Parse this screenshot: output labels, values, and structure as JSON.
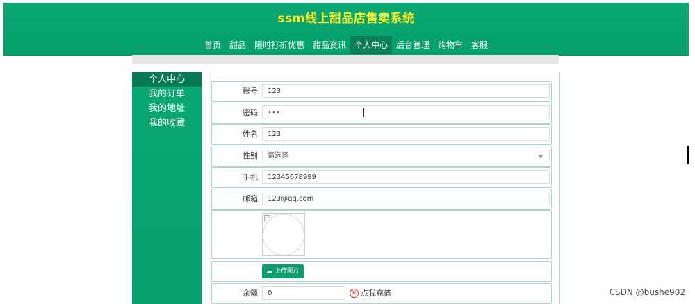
{
  "site": {
    "title": "ssm线上甜品店售卖系统"
  },
  "nav": {
    "items": [
      "首页",
      "甜品",
      "限时打折优惠",
      "甜品资讯",
      "个人中心",
      "后台管理",
      "购物车",
      "客服"
    ]
  },
  "sidebar": {
    "items": [
      "个人中心",
      "我的订单",
      "我的地址",
      "我的收藏"
    ]
  },
  "form": {
    "account": {
      "label": "账号",
      "value": "123"
    },
    "password": {
      "label": "密码",
      "value": "•••"
    },
    "name": {
      "label": "姓名",
      "value": "123"
    },
    "gender": {
      "label": "性别",
      "value": "请选择"
    },
    "phone": {
      "label": "手机",
      "value": "12345678999"
    },
    "email": {
      "label": "邮箱",
      "value": "123@qq.com"
    },
    "upload_label": "上传图片",
    "balance": {
      "label": "余额",
      "value": "0"
    },
    "recharge_label": "点我充值"
  },
  "watermark": "CSDN @bushe902",
  "colors": {
    "primary": "#0aa874",
    "title": "#ffef2a",
    "active": "#087a51"
  }
}
